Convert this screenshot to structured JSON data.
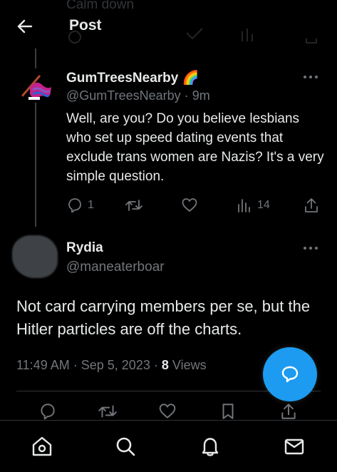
{
  "header": {
    "title": "Post",
    "ghost_text": "Calm down",
    "back_icon": "arrow-left-icon"
  },
  "tweet1": {
    "display_name": "GumTreesNearby",
    "emoji": "🌈",
    "handle": "@GumTreesNearby",
    "separator": "·",
    "time": "9m",
    "text": "Well, are you? Do you believe lesbians who set up speed dating events that exclude trans women are Nazis? It's a very simple question.",
    "actions": {
      "reply_count": "1",
      "retweet_count": "",
      "like_count": "",
      "views_count": "14"
    }
  },
  "tweet2": {
    "display_name": "Rydia",
    "handle": "@maneaterboar",
    "text": "Not card carrying members per se, but the Hitler particles are off the charts.",
    "time": "11:49 AM",
    "dot1": "·",
    "date": "Sep 5, 2023",
    "dot2": "·",
    "views_count": "8",
    "views_label": "Views"
  },
  "colors": {
    "background": "#000000",
    "text": "#e7e9ea",
    "muted": "#71767b",
    "accent": "#1d9bf0",
    "divider": "#2f3336"
  },
  "bottom_nav": [
    "home-icon",
    "search-icon",
    "bell-icon",
    "mail-icon"
  ]
}
